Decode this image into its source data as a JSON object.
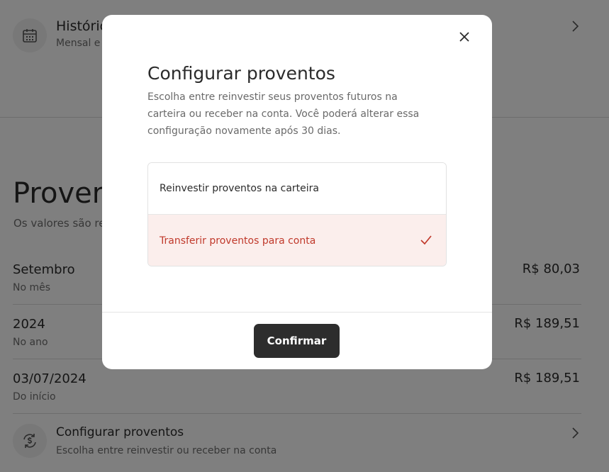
{
  "background": {
    "historico": {
      "title": "Histórico",
      "subtitle": "Mensal e a"
    },
    "proventos": {
      "title": "Provent",
      "subtitle": "Os valores são rec"
    },
    "stats": [
      {
        "label": "Setembro",
        "sub": "No mês",
        "value": "R$ 80,03"
      },
      {
        "label": "2024",
        "sub": "No ano",
        "value": "R$ 189,51"
      },
      {
        "label": "03/07/2024",
        "sub": "Do início",
        "value": "R$ 189,51"
      }
    ],
    "config_row": {
      "title": "Configurar proventos",
      "subtitle": "Escolha entre reinvestir ou receber na conta"
    }
  },
  "modal": {
    "title": "Configurar proventos",
    "description": "Escolha entre reinvestir seus proventos futuros na carteira ou receber na conta. Você poderá alterar essa configuração novamente após 30 dias.",
    "options": [
      {
        "label": "Reinvestir proventos na carteira",
        "selected": false
      },
      {
        "label": "Transferir proventos para conta",
        "selected": true
      }
    ],
    "confirm_label": "Confirmar"
  },
  "colors": {
    "selected_text": "#c0392b",
    "selected_bg": "#fbeeec",
    "button_bg": "#2d2d2d"
  },
  "icons": [
    "calendar-icon",
    "chevron-right-icon",
    "close-icon",
    "check-icon",
    "dollar-refresh-icon"
  ]
}
